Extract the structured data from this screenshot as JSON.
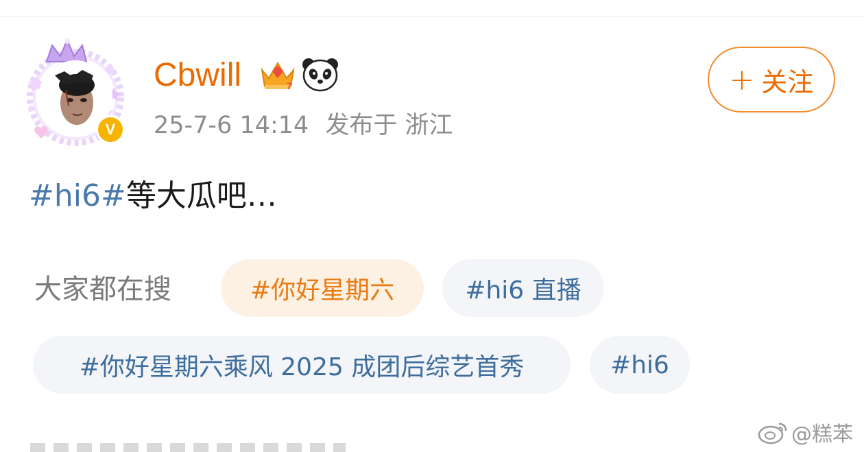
{
  "post": {
    "username": "Cbwill",
    "timestamp": "25-7-6 14:14",
    "location": "发布于 浙江",
    "text_tag": "#hi6#",
    "text_body": "等大瓜吧…",
    "verified_mark": "V"
  },
  "follow": {
    "plus": "+",
    "label": "关注"
  },
  "search": {
    "label": "大家都在搜",
    "chips": [
      "#你好星期六",
      "#hi6 直播",
      "#你好星期六乘风 2025 成团后综艺首秀",
      "#hi6"
    ]
  },
  "watermark": {
    "text": "@糕苯"
  },
  "colors": {
    "accent": "#eb6b00",
    "tag_blue": "#4a7aaa",
    "meta_gray": "#8c8c8c"
  },
  "icons": [
    "crown-avatar-frame",
    "verified-badge-icon",
    "crown-level-icon",
    "panda-icon",
    "weibo-logo-icon"
  ]
}
